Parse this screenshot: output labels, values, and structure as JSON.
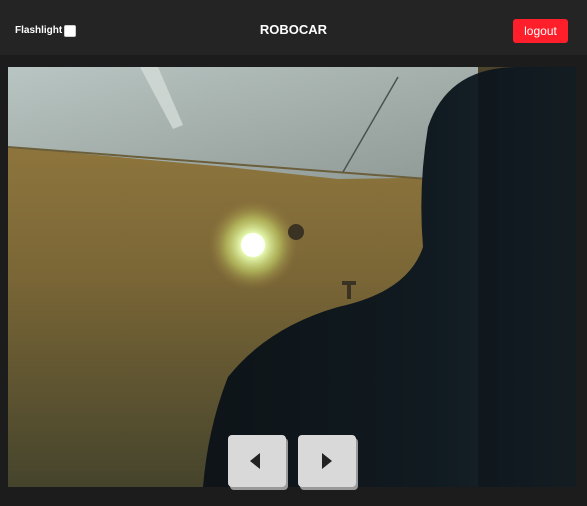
{
  "header": {
    "flashlight_label": "Flashlight",
    "flashlight_checked": false,
    "title": "ROBOCAR",
    "logout_label": "logout"
  },
  "colors": {
    "background": "#1c1c1c",
    "topbar": "#242424",
    "logout": "#ff1f2a",
    "control_button": "#d9d9d9"
  },
  "controls": {
    "left_icon": "chevron-left-icon",
    "right_icon": "chevron-right-icon"
  }
}
